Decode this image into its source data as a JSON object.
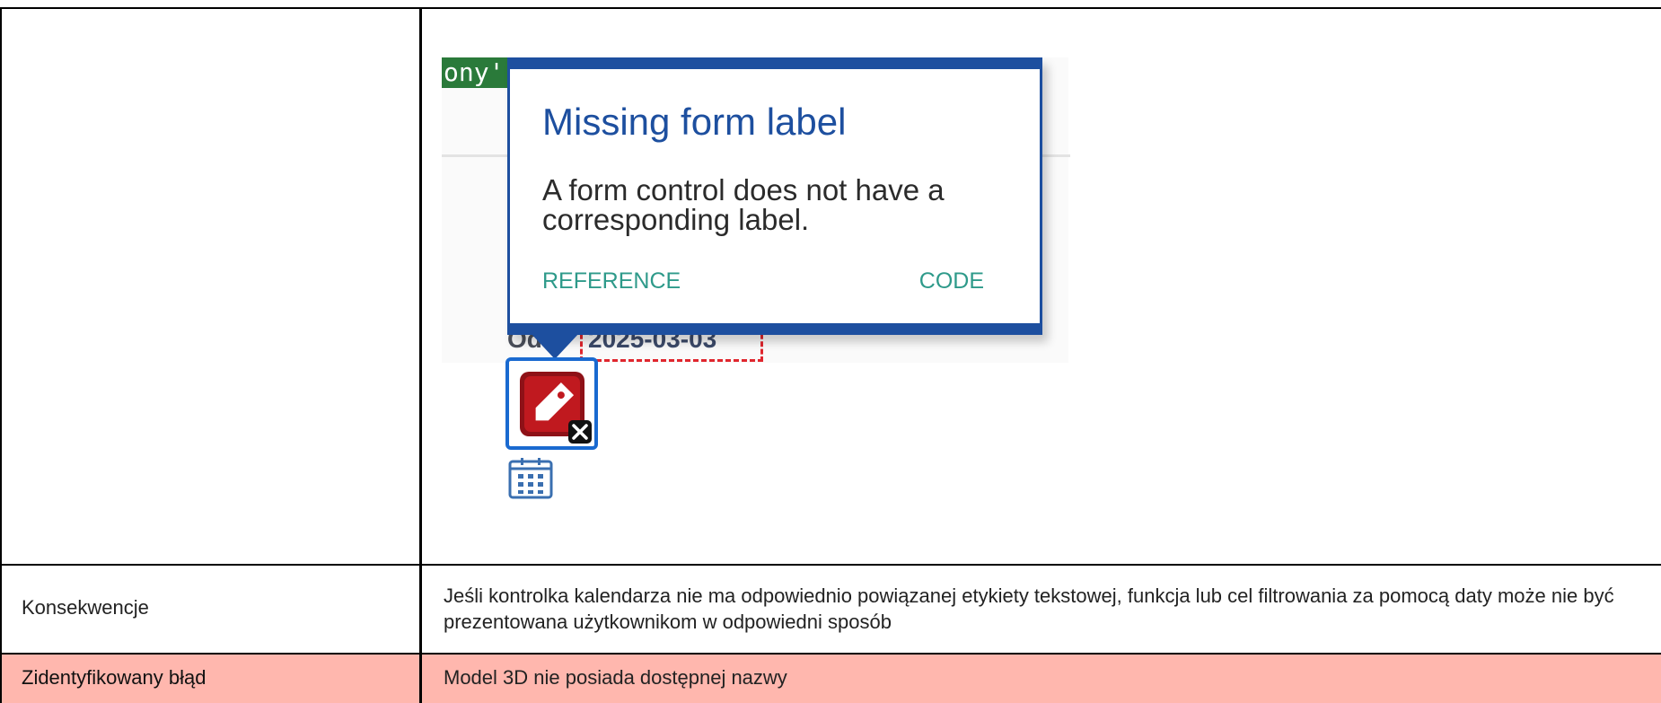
{
  "screenshot": {
    "green_tag_text": "ony'",
    "date_prefix": "Od",
    "date_value": "2025-03-03",
    "popup": {
      "title": "Missing form label",
      "description": "A form control does not have a corresponding label.",
      "reference_label": "REFERENCE",
      "code_label": "CODE"
    },
    "error_icon": "tag-error-icon",
    "calendar_icon": "calendar-icon"
  },
  "rows": [
    {
      "label": "Konsekwencje",
      "text": "Jeśli kontrolka kalendarza nie ma odpowiednio powiązanej etykiety tekstowej, funkcja lub cel filtrowania za pomocą daty może nie być prezentowana użytkownikom w odpowiedni sposób"
    },
    {
      "label": "Zidentyfikowany błąd",
      "text": "Model 3D nie posiada dostępnej nazwy"
    }
  ],
  "colors": {
    "highlight_row": "#ffb7ae",
    "popup_accent": "#1d4f9f",
    "link": "#2e9a8a",
    "error_red": "#c0191f"
  }
}
